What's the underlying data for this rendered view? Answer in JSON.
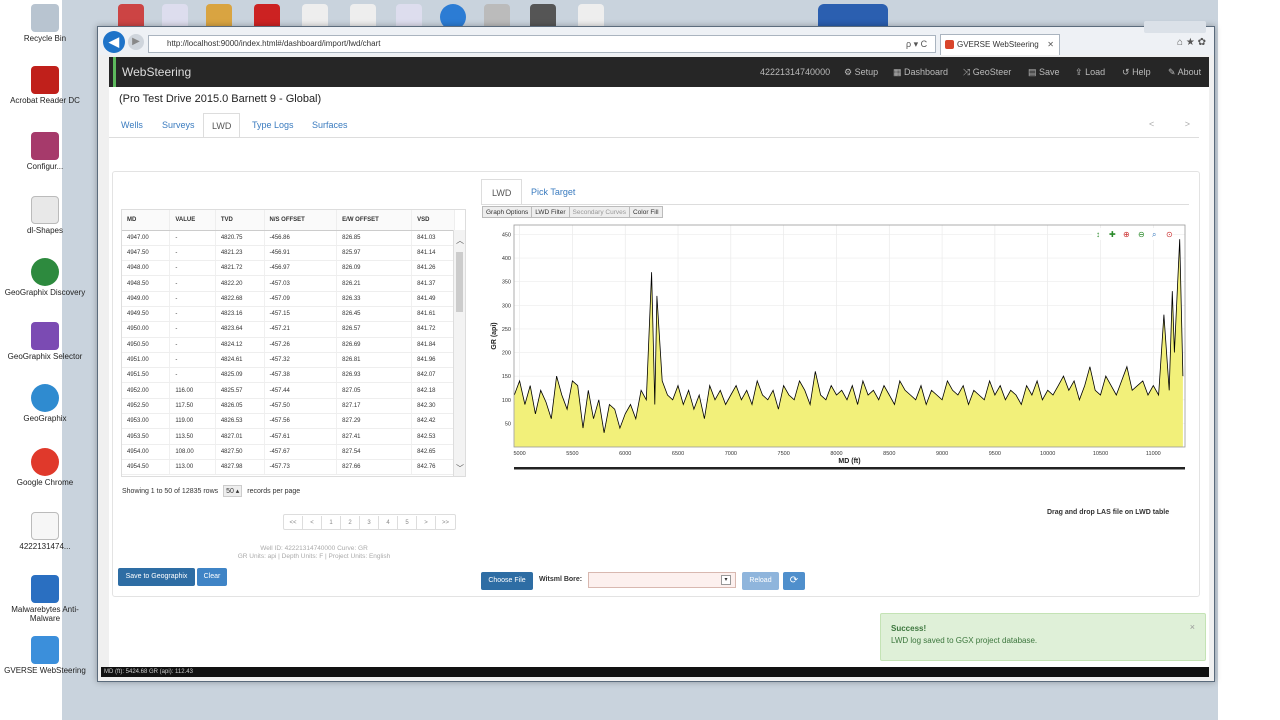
{
  "desktop": {
    "icons": [
      "Recycle Bin",
      "Acrobat Reader DC",
      "Configur...",
      "dl-Shapes",
      "GeoGraphix Discovery",
      "GeoGraphix Selector",
      "GeoGraphix",
      "Google Chrome",
      "4222131474...",
      "Malwarebytes Anti-Malware",
      "GVERSE WebSteering"
    ]
  },
  "browser": {
    "url": "http://localhost:9000/index.html#/dashboard/import/lwd/chart",
    "tab_title": "GVERSE WebSteering",
    "addr_ctrls": "ρ ▾ C",
    "tab_close": "✕",
    "back": "◀",
    "fwd": "▶",
    "ctrl_icons": "⌂ ★ ✿"
  },
  "navbar": {
    "brand": "WebSteering",
    "well_id": "42221314740000",
    "items": [
      "Setup",
      "Dashboard",
      "GeoSteer",
      "Save",
      "Load",
      "Help",
      "About"
    ],
    "icons": [
      "⚙",
      "▦",
      "⤨",
      "▤",
      "⇪",
      "↺",
      "✎"
    ]
  },
  "page": {
    "title": "(Pro Test Drive 2015.0 Barnett 9 - Global)",
    "tabs": [
      "Wells",
      "Surveys",
      "LWD",
      "Type Logs",
      "Surfaces"
    ],
    "active_tab": "LWD",
    "pager": "< >"
  },
  "lwd_table": {
    "columns": [
      "MD",
      "VALUE",
      "TVD",
      "N/S OFFSET",
      "E/W OFFSET",
      "VSD"
    ],
    "rows": [
      [
        "4947.00",
        "-",
        "4820.75",
        "-456.86",
        "826.85",
        "841.03"
      ],
      [
        "4947.50",
        "-",
        "4821.23",
        "-456.91",
        "825.97",
        "841.14"
      ],
      [
        "4948.00",
        "-",
        "4821.72",
        "-456.97",
        "826.09",
        "841.26"
      ],
      [
        "4948.50",
        "-",
        "4822.20",
        "-457.03",
        "826.21",
        "841.37"
      ],
      [
        "4949.00",
        "-",
        "4822.68",
        "-457.09",
        "826.33",
        "841.49"
      ],
      [
        "4949.50",
        "-",
        "4823.16",
        "-457.15",
        "826.45",
        "841.61"
      ],
      [
        "4950.00",
        "-",
        "4823.64",
        "-457.21",
        "826.57",
        "841.72"
      ],
      [
        "4950.50",
        "-",
        "4824.12",
        "-457.26",
        "826.69",
        "841.84"
      ],
      [
        "4951.00",
        "-",
        "4824.61",
        "-457.32",
        "826.81",
        "841.96"
      ],
      [
        "4951.50",
        "-",
        "4825.09",
        "-457.38",
        "826.93",
        "842.07"
      ],
      [
        "4952.00",
        "116.00",
        "4825.57",
        "-457.44",
        "827.05",
        "842.18"
      ],
      [
        "4952.50",
        "117.50",
        "4826.05",
        "-457.50",
        "827.17",
        "842.30"
      ],
      [
        "4953.00",
        "119.00",
        "4826.53",
        "-457.56",
        "827.29",
        "842.42"
      ],
      [
        "4953.50",
        "113.50",
        "4827.01",
        "-457.61",
        "827.41",
        "842.53"
      ],
      [
        "4954.00",
        "108.00",
        "4827.50",
        "-457.67",
        "827.54",
        "842.65"
      ],
      [
        "4954.50",
        "113.00",
        "4827.98",
        "-457.73",
        "827.66",
        "842.76"
      ]
    ],
    "showing_text": "Showing 1 to 50 of 12835 rows",
    "rows_per_page": "50 ▴",
    "records_label": "records per page",
    "pages": [
      "<<",
      "<",
      "1",
      "2",
      "3",
      "4",
      "5",
      ">",
      ">>"
    ],
    "scroll_up": "︿",
    "scroll_down": "﹀"
  },
  "well_info": {
    "line1": "Well ID: 42221314740000 Curve: GR",
    "line2": "GR Units: api | Depth Units: F | Project Units: English"
  },
  "left_buttons": {
    "save": "Save to Geographix",
    "clear": "Clear"
  },
  "right_tabs": [
    "LWD",
    "Pick Target"
  ],
  "graph_buttons": [
    "Graph Options",
    "LWD Filter",
    "Secondary Curves",
    "Color Fill"
  ],
  "chart_data": {
    "type": "area",
    "xlabel": "MD (ft)",
    "ylabel": "GR (api)",
    "xlim": [
      4947,
      11300
    ],
    "ylim": [
      0,
      470
    ],
    "xticks": [
      5000,
      5500,
      6000,
      6500,
      7000,
      7500,
      8000,
      8500,
      9000,
      9500,
      10000,
      10500,
      11000
    ],
    "yticks": [
      50,
      100,
      150,
      200,
      250,
      300,
      350,
      400,
      450
    ],
    "fill_color": "#f2f07a",
    "line_color": "#000000",
    "series": [
      {
        "x": [
          4950,
          5000,
          5050,
          5100,
          5150,
          5200,
          5250,
          5300,
          5350,
          5400,
          5450,
          5500,
          5550,
          5600,
          5650,
          5700,
          5750,
          5800,
          5850,
          5900,
          5950,
          6000,
          6050,
          6100,
          6150,
          6200,
          6250,
          6280,
          6300,
          6350,
          6400,
          6450,
          6500,
          6550,
          6600,
          6650,
          6700,
          6750,
          6800,
          6850,
          6900,
          6950,
          7000,
          7050,
          7100,
          7150,
          7200,
          7250,
          7300,
          7350,
          7400,
          7450,
          7500,
          7550,
          7600,
          7650,
          7700,
          7750,
          7800,
          7850,
          7900,
          7950,
          8000,
          8050,
          8100,
          8150,
          8200,
          8250,
          8300,
          8350,
          8400,
          8450,
          8500,
          8550,
          8600,
          8650,
          8700,
          8750,
          8800,
          8850,
          8900,
          8950,
          9000,
          9050,
          9100,
          9150,
          9200,
          9250,
          9300,
          9350,
          9400,
          9450,
          9500,
          9550,
          9600,
          9650,
          9700,
          9750,
          9800,
          9850,
          9900,
          9950,
          10000,
          10050,
          10100,
          10150,
          10200,
          10250,
          10300,
          10350,
          10400,
          10450,
          10500,
          10550,
          10600,
          10650,
          10700,
          10750,
          10800,
          10850,
          10900,
          10950,
          11000,
          11050,
          11100,
          11150,
          11180,
          11200,
          11250,
          11280
        ],
        "y": [
          110,
          140,
          90,
          130,
          70,
          120,
          95,
          60,
          150,
          110,
          80,
          140,
          130,
          40,
          120,
          60,
          100,
          30,
          90,
          80,
          40,
          70,
          90,
          60,
          120,
          100,
          370,
          90,
          320,
          140,
          110,
          100,
          130,
          90,
          120,
          80,
          110,
          60,
          130,
          100,
          120,
          90,
          110,
          130,
          100,
          120,
          90,
          140,
          110,
          100,
          120,
          80,
          130,
          110,
          100,
          140,
          120,
          90,
          160,
          110,
          100,
          130,
          110,
          120,
          100,
          130,
          90,
          140,
          110,
          120,
          100,
          130,
          110,
          90,
          140,
          120,
          110,
          100,
          130,
          90,
          120,
          110,
          100,
          140,
          120,
          110,
          130,
          90,
          120,
          110,
          100,
          140,
          110,
          130,
          100,
          120,
          110,
          90,
          130,
          110,
          140,
          100,
          120,
          110,
          130,
          150,
          120,
          140,
          100,
          130,
          170,
          120,
          110,
          150,
          130,
          110,
          140,
          170,
          120,
          130,
          140,
          110,
          130,
          110,
          280,
          120,
          330,
          200,
          440,
          150
        ]
      }
    ]
  },
  "drag_drop_hint": "Drag and drop LAS file on LWD table",
  "bottom": {
    "choose_file": "Choose File",
    "witsml_label": "Witsml Bore:",
    "reload": "Reload",
    "refresh_icon": "⟳",
    "select_caret": "▾"
  },
  "toast": {
    "title": "Success!",
    "message": "LWD log saved to GGX project database.",
    "close": "×"
  },
  "status_bar": "MD (ft): 5424.68 GR (api): 112.43"
}
